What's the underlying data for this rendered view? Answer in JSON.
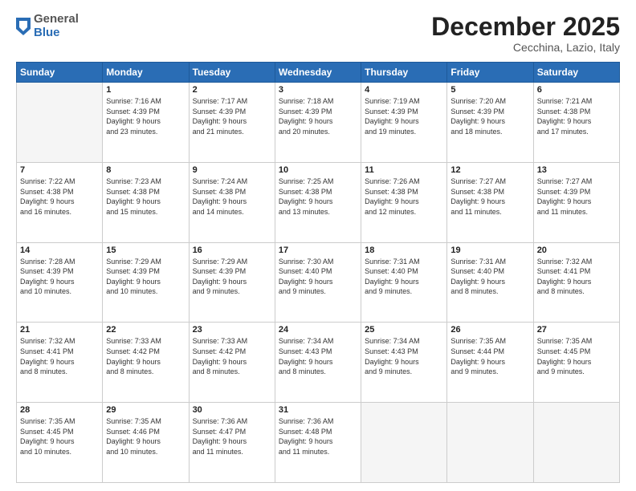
{
  "header": {
    "logo": {
      "general": "General",
      "blue": "Blue"
    },
    "title": "December 2025",
    "location": "Cecchina, Lazio, Italy"
  },
  "weekdays": [
    "Sunday",
    "Monday",
    "Tuesday",
    "Wednesday",
    "Thursday",
    "Friday",
    "Saturday"
  ],
  "weeks": [
    [
      {
        "day": "",
        "info": ""
      },
      {
        "day": "1",
        "info": "Sunrise: 7:16 AM\nSunset: 4:39 PM\nDaylight: 9 hours\nand 23 minutes."
      },
      {
        "day": "2",
        "info": "Sunrise: 7:17 AM\nSunset: 4:39 PM\nDaylight: 9 hours\nand 21 minutes."
      },
      {
        "day": "3",
        "info": "Sunrise: 7:18 AM\nSunset: 4:39 PM\nDaylight: 9 hours\nand 20 minutes."
      },
      {
        "day": "4",
        "info": "Sunrise: 7:19 AM\nSunset: 4:39 PM\nDaylight: 9 hours\nand 19 minutes."
      },
      {
        "day": "5",
        "info": "Sunrise: 7:20 AM\nSunset: 4:39 PM\nDaylight: 9 hours\nand 18 minutes."
      },
      {
        "day": "6",
        "info": "Sunrise: 7:21 AM\nSunset: 4:38 PM\nDaylight: 9 hours\nand 17 minutes."
      }
    ],
    [
      {
        "day": "7",
        "info": "Sunrise: 7:22 AM\nSunset: 4:38 PM\nDaylight: 9 hours\nand 16 minutes."
      },
      {
        "day": "8",
        "info": "Sunrise: 7:23 AM\nSunset: 4:38 PM\nDaylight: 9 hours\nand 15 minutes."
      },
      {
        "day": "9",
        "info": "Sunrise: 7:24 AM\nSunset: 4:38 PM\nDaylight: 9 hours\nand 14 minutes."
      },
      {
        "day": "10",
        "info": "Sunrise: 7:25 AM\nSunset: 4:38 PM\nDaylight: 9 hours\nand 13 minutes."
      },
      {
        "day": "11",
        "info": "Sunrise: 7:26 AM\nSunset: 4:38 PM\nDaylight: 9 hours\nand 12 minutes."
      },
      {
        "day": "12",
        "info": "Sunrise: 7:27 AM\nSunset: 4:38 PM\nDaylight: 9 hours\nand 11 minutes."
      },
      {
        "day": "13",
        "info": "Sunrise: 7:27 AM\nSunset: 4:39 PM\nDaylight: 9 hours\nand 11 minutes."
      }
    ],
    [
      {
        "day": "14",
        "info": "Sunrise: 7:28 AM\nSunset: 4:39 PM\nDaylight: 9 hours\nand 10 minutes."
      },
      {
        "day": "15",
        "info": "Sunrise: 7:29 AM\nSunset: 4:39 PM\nDaylight: 9 hours\nand 10 minutes."
      },
      {
        "day": "16",
        "info": "Sunrise: 7:29 AM\nSunset: 4:39 PM\nDaylight: 9 hours\nand 9 minutes."
      },
      {
        "day": "17",
        "info": "Sunrise: 7:30 AM\nSunset: 4:40 PM\nDaylight: 9 hours\nand 9 minutes."
      },
      {
        "day": "18",
        "info": "Sunrise: 7:31 AM\nSunset: 4:40 PM\nDaylight: 9 hours\nand 9 minutes."
      },
      {
        "day": "19",
        "info": "Sunrise: 7:31 AM\nSunset: 4:40 PM\nDaylight: 9 hours\nand 8 minutes."
      },
      {
        "day": "20",
        "info": "Sunrise: 7:32 AM\nSunset: 4:41 PM\nDaylight: 9 hours\nand 8 minutes."
      }
    ],
    [
      {
        "day": "21",
        "info": "Sunrise: 7:32 AM\nSunset: 4:41 PM\nDaylight: 9 hours\nand 8 minutes."
      },
      {
        "day": "22",
        "info": "Sunrise: 7:33 AM\nSunset: 4:42 PM\nDaylight: 9 hours\nand 8 minutes."
      },
      {
        "day": "23",
        "info": "Sunrise: 7:33 AM\nSunset: 4:42 PM\nDaylight: 9 hours\nand 8 minutes."
      },
      {
        "day": "24",
        "info": "Sunrise: 7:34 AM\nSunset: 4:43 PM\nDaylight: 9 hours\nand 8 minutes."
      },
      {
        "day": "25",
        "info": "Sunrise: 7:34 AM\nSunset: 4:43 PM\nDaylight: 9 hours\nand 9 minutes."
      },
      {
        "day": "26",
        "info": "Sunrise: 7:35 AM\nSunset: 4:44 PM\nDaylight: 9 hours\nand 9 minutes."
      },
      {
        "day": "27",
        "info": "Sunrise: 7:35 AM\nSunset: 4:45 PM\nDaylight: 9 hours\nand 9 minutes."
      }
    ],
    [
      {
        "day": "28",
        "info": "Sunrise: 7:35 AM\nSunset: 4:45 PM\nDaylight: 9 hours\nand 10 minutes."
      },
      {
        "day": "29",
        "info": "Sunrise: 7:35 AM\nSunset: 4:46 PM\nDaylight: 9 hours\nand 10 minutes."
      },
      {
        "day": "30",
        "info": "Sunrise: 7:36 AM\nSunset: 4:47 PM\nDaylight: 9 hours\nand 11 minutes."
      },
      {
        "day": "31",
        "info": "Sunrise: 7:36 AM\nSunset: 4:48 PM\nDaylight: 9 hours\nand 11 minutes."
      },
      {
        "day": "",
        "info": ""
      },
      {
        "day": "",
        "info": ""
      },
      {
        "day": "",
        "info": ""
      }
    ]
  ]
}
